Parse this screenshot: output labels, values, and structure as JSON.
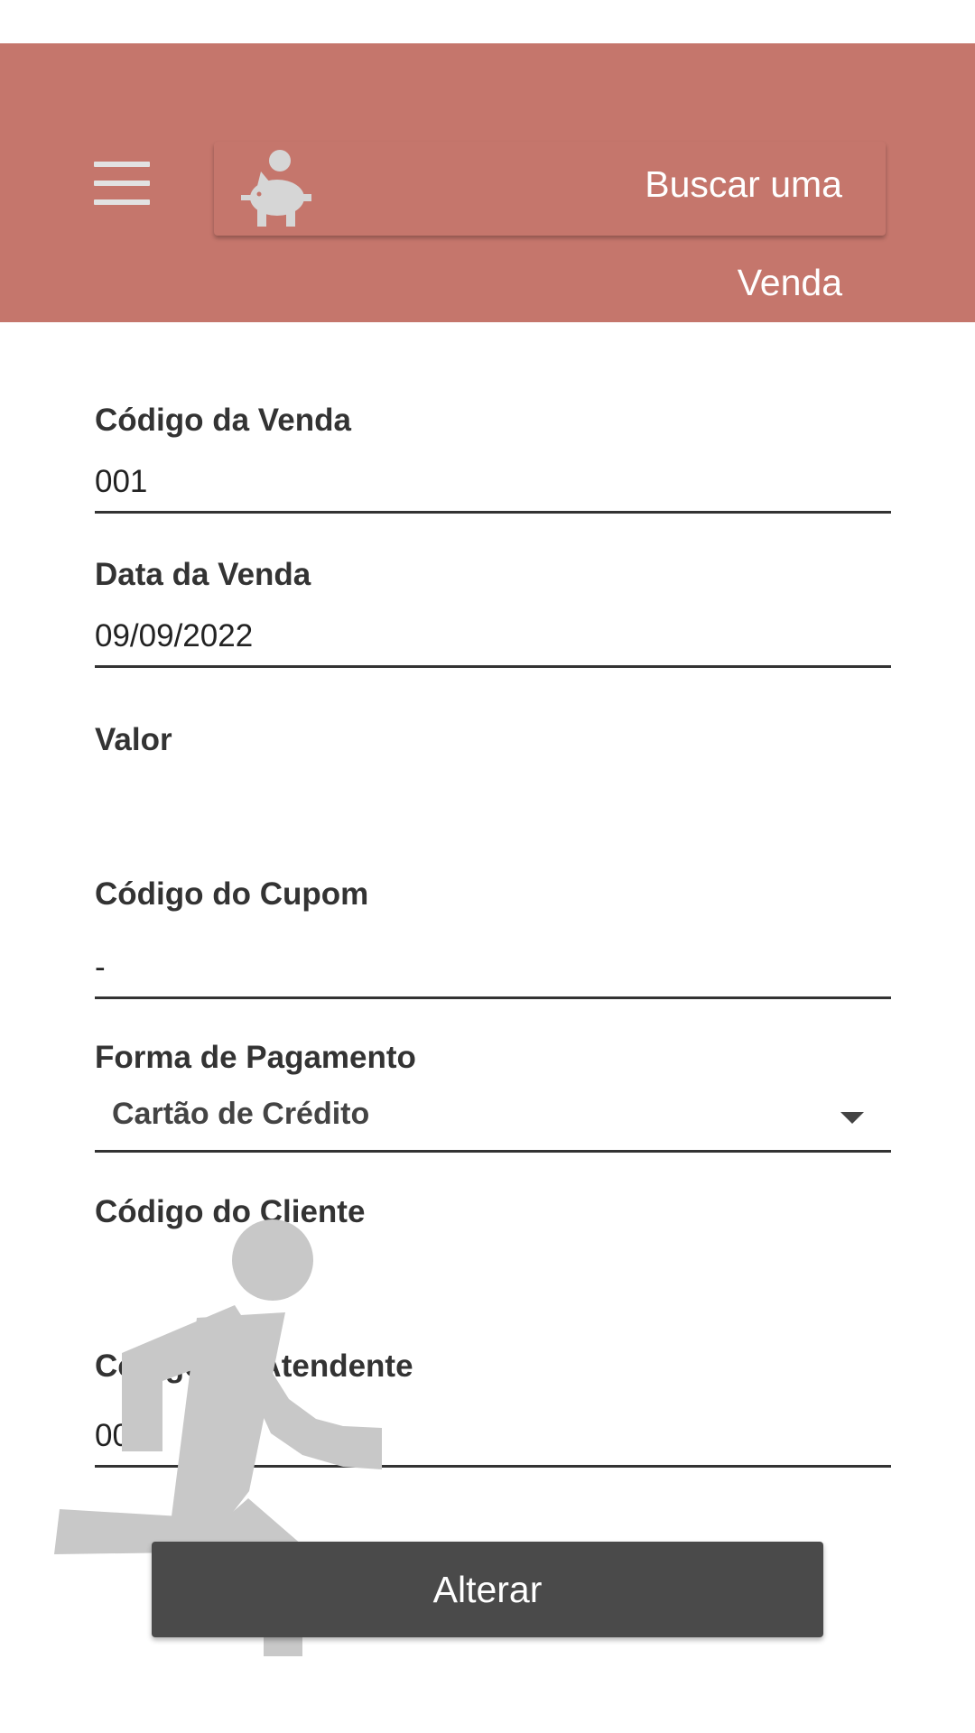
{
  "header": {
    "menu_icon": "hamburger-menu-icon",
    "search_icon": "piggy-bank-icon",
    "search_label_line1": "Buscar uma",
    "search_label_line2": "Venda",
    "background_color": "#c5766c"
  },
  "form": {
    "codigo_venda": {
      "label": "Código da Venda",
      "value": "001"
    },
    "data_venda": {
      "label": "Data da Venda",
      "value": "09/09/2022"
    },
    "valor": {
      "label": "Valor",
      "value": ""
    },
    "codigo_cupom": {
      "label": "Código do Cupom",
      "value": "-"
    },
    "forma_pagamento": {
      "label": "Forma de Pagamento",
      "selected": "Cartão de Crédito"
    },
    "codigo_cliente": {
      "label": "Código do Cliente",
      "value": ""
    },
    "codigo_atendente": {
      "label": "Código do Atendente",
      "value": "00"
    }
  },
  "overlay_icon": "running-person-icon",
  "actions": {
    "submit_label": "Alterar"
  }
}
